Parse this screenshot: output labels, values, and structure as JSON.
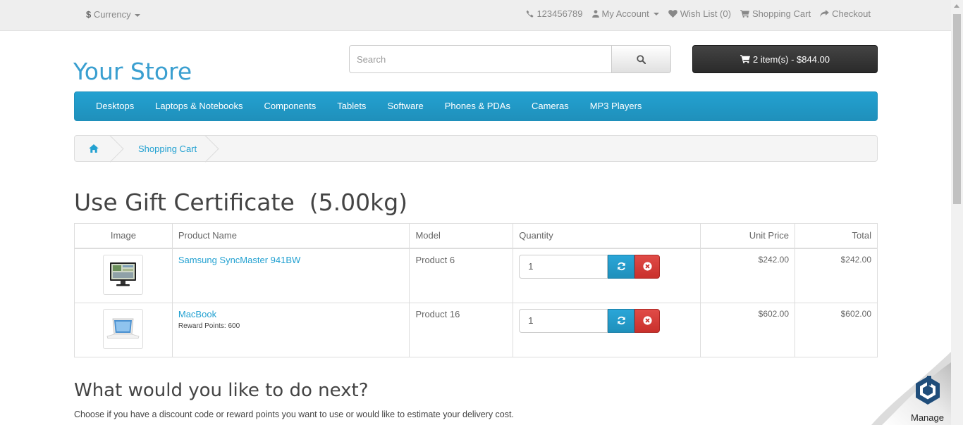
{
  "topbar": {
    "currency_symbol": "$",
    "currency_label": "Currency",
    "phone": "123456789",
    "my_account": "My Account",
    "wish_list": "Wish List (0)",
    "shopping_cart": "Shopping Cart",
    "checkout": "Checkout"
  },
  "header": {
    "logo": "Your Store",
    "search_placeholder": "Search",
    "cart_summary": "2 item(s) - $844.00"
  },
  "menu": {
    "items": [
      "Desktops",
      "Laptops & Notebooks",
      "Components",
      "Tablets",
      "Software",
      "Phones & PDAs",
      "Cameras",
      "MP3 Players"
    ]
  },
  "breadcrumb": {
    "current": "Shopping Cart"
  },
  "page": {
    "title": "Use Gift Certificate  (5.00kg)"
  },
  "table": {
    "headers": {
      "image": "Image",
      "name": "Product Name",
      "model": "Model",
      "quantity": "Quantity",
      "unit_price": "Unit Price",
      "total": "Total"
    },
    "rows": [
      {
        "name": "Samsung SyncMaster 941BW",
        "reward": "",
        "model": "Product 6",
        "quantity": "1",
        "unit_price": "$242.00",
        "total": "$242.00",
        "image_icon": "monitor-thumbnail"
      },
      {
        "name": "MacBook",
        "reward": "Reward Points: 600",
        "model": "Product 16",
        "quantity": "1",
        "unit_price": "$602.00",
        "total": "$602.00",
        "image_icon": "laptop-thumbnail"
      }
    ]
  },
  "next": {
    "title": "What would you like to do next?",
    "description": "Choose if you have a discount code or reward points you want to use or would like to estimate your delivery cost."
  },
  "manage_badge": {
    "label": "Manage"
  },
  "colors": {
    "accent": "#23a1d1",
    "danger": "#c9302c",
    "dark_button": "#303030"
  }
}
